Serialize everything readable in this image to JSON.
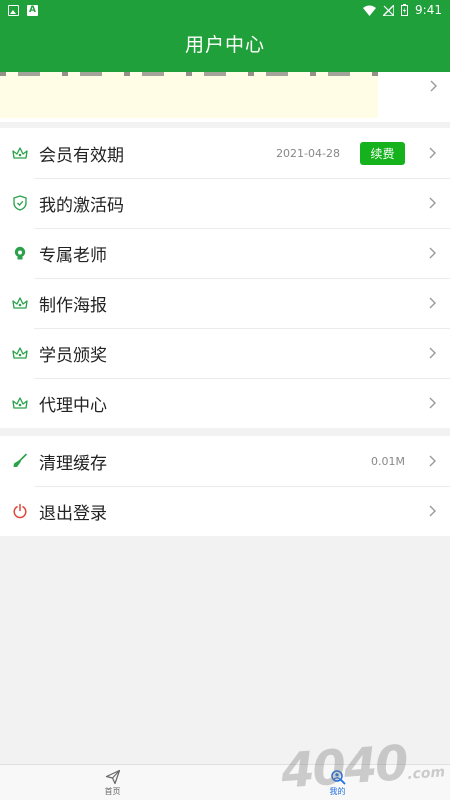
{
  "status_bar": {
    "time": "9:41"
  },
  "header": {
    "title": "用户中心"
  },
  "membership_group": [
    {
      "label": "会员有效期",
      "value": "2021-04-28",
      "action": "续费",
      "icon": "crown-icon"
    },
    {
      "label": "我的激活码",
      "icon": "shield-icon"
    },
    {
      "label": "专属老师",
      "icon": "teacher-icon"
    },
    {
      "label": "制作海报",
      "icon": "crown-icon"
    },
    {
      "label": "学员颁奖",
      "icon": "crown-icon"
    },
    {
      "label": "代理中心",
      "icon": "crown-icon"
    }
  ],
  "settings_group": [
    {
      "label": "清理缓存",
      "value": "0.01M",
      "icon": "broom-icon"
    },
    {
      "label": "退出登录",
      "icon": "power-icon"
    }
  ],
  "tabbar": [
    {
      "label": "首页",
      "icon": "paper-plane-icon",
      "active": false
    },
    {
      "label": "我的",
      "icon": "profile-icon",
      "active": true
    }
  ],
  "colors": {
    "primary": "#1fa03a",
    "renew_button": "#15b21d",
    "logout_icon": "#e0463a",
    "active_tab": "#1f6fe0"
  },
  "watermark": {
    "text": "4040",
    "suffix": ".com"
  }
}
